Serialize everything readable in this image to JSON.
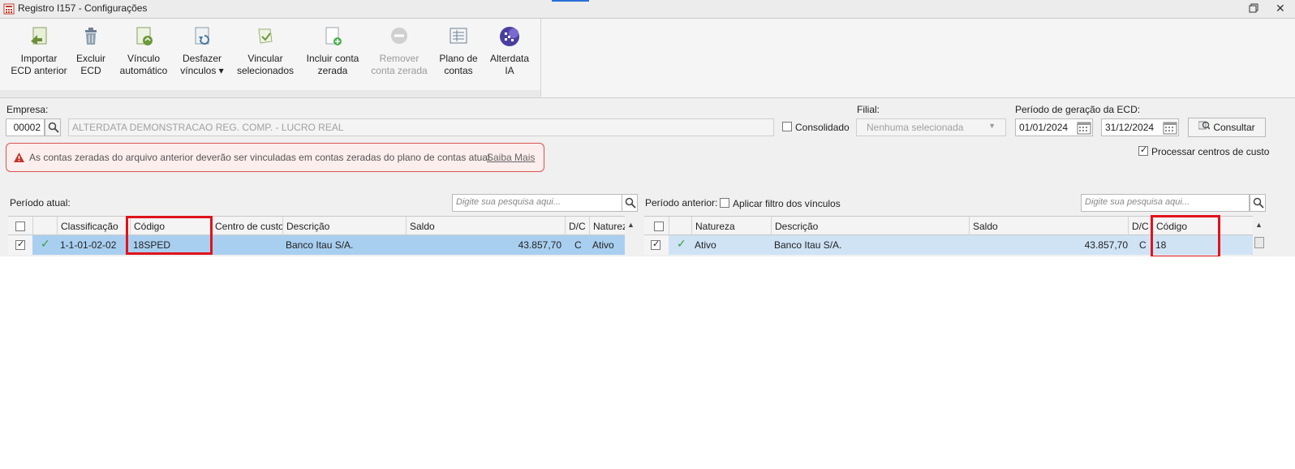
{
  "window": {
    "title": "Registro I157 - Configurações"
  },
  "ribbon": {
    "buttons": [
      {
        "label": "Importar\nECD anterior",
        "icon": "import-ecd-icon",
        "disabled": false
      },
      {
        "label": "Excluir\nECD",
        "icon": "trash-icon",
        "disabled": false
      },
      {
        "label": "Vínculo\nautomático",
        "icon": "auto-link-icon",
        "disabled": false
      },
      {
        "label": "Desfazer\nvínculos ▾",
        "icon": "undo-link-icon",
        "disabled": false
      },
      {
        "label": "Vincular\nselecionados",
        "icon": "link-selected-icon",
        "disabled": false
      },
      {
        "label": "Incluir conta\nzerada",
        "icon": "add-document-icon",
        "disabled": false
      },
      {
        "label": "Remover\nconta zerada",
        "icon": "remove-icon",
        "disabled": true
      },
      {
        "label": "Plano de\ncontas",
        "icon": "chart-of-accounts-icon",
        "disabled": false
      },
      {
        "label": "Alterdata\nIA",
        "icon": "alterdata-ia-icon",
        "disabled": false
      }
    ]
  },
  "filters": {
    "empresa_label": "Empresa:",
    "empresa_code": "00002",
    "empresa_name": "ALTERDATA DEMONSTRACAO REG. COMP. - LUCRO REAL",
    "consolidado_label": "Consolidado",
    "consolidado_checked": false,
    "filial_label": "Filial:",
    "filial_value": "Nenhuma selecionada",
    "periodo_label": "Período de geração da ECD:",
    "date_start": "01/01/2024",
    "date_end": "31/12/2024",
    "consultar_label": "Consultar",
    "processar_label": "Processar centros de custo",
    "processar_checked": true
  },
  "alert": {
    "message": "As contas zeradas do arquivo anterior deverão ser vinculadas em contas zeradas do plano de contas atual.",
    "link": "Saiba Mais",
    "color": "#d9534f"
  },
  "left_panel": {
    "title": "Período atual:",
    "search_placeholder": "Digite sua pesquisa aqui...",
    "columns": [
      "Classificação",
      "Código",
      "Centro de custo",
      "Descrição",
      "Saldo",
      "D/C",
      "Naturez"
    ],
    "rows": [
      {
        "checked": true,
        "linked": true,
        "classificacao": "1-1-01-02-02",
        "codigo": "18SPED",
        "centro": "",
        "descricao": "Banco Itau S/A.",
        "saldo": "43.857,70",
        "dc": "C",
        "natureza": "Ativo"
      }
    ]
  },
  "right_panel": {
    "title": "Período anterior:",
    "filter_label": "Aplicar filtro dos vínculos",
    "filter_checked": false,
    "search_placeholder": "Digite sua pesquisa aqui...",
    "columns": [
      "Natureza",
      "Descrição",
      "Saldo",
      "D/C",
      "Código"
    ],
    "rows": [
      {
        "checked": true,
        "linked": true,
        "natureza": "Ativo",
        "descricao": "Banco Itau S/A.",
        "saldo": "43.857,70",
        "dc": "C",
        "codigo": "18"
      }
    ]
  },
  "colors": {
    "selected_row": "#a9cff0",
    "selected_row_light": "#cfe3f5",
    "highlight_box": "#e0131b",
    "check_green": "#3a9a3a"
  }
}
